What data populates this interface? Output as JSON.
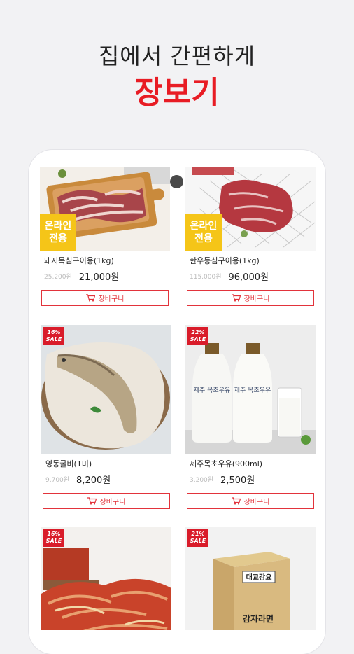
{
  "headline": {
    "line1": "집에서 간편하게",
    "line2": "장보기"
  },
  "cart_label": "장바구니",
  "online_badge": [
    "온라인",
    "전용"
  ],
  "sale_suffix": "SALE",
  "products": [
    {
      "name": "돼지목심구이용(1kg)",
      "old_price": "25,200원",
      "price": "21,000원",
      "badge": "online"
    },
    {
      "name": "한우등심구이용(1kg)",
      "old_price": "115,000원",
      "price": "96,000원",
      "badge": "online"
    },
    {
      "name": "영동굴비(1미)",
      "old_price": "9,700원",
      "price": "8,200원",
      "badge": "sale",
      "discount": "16%"
    },
    {
      "name": "제주목초우유(900ml)",
      "old_price": "3,200원",
      "price": "2,500원",
      "badge": "sale",
      "discount": "22%"
    },
    {
      "name": "",
      "old_price": "",
      "price": "",
      "badge": "sale",
      "discount": "16%"
    },
    {
      "name": "",
      "old_price": "",
      "price": "",
      "badge": "sale",
      "discount": "21%"
    }
  ],
  "image_text": {
    "milk_label": "제주 목초우유",
    "box_label": "감자라면",
    "box_top": "대교감요"
  },
  "colors": {
    "accent": "#e81c24",
    "online_badge": "#f5c518",
    "sale_badge": "#d91c2a"
  }
}
